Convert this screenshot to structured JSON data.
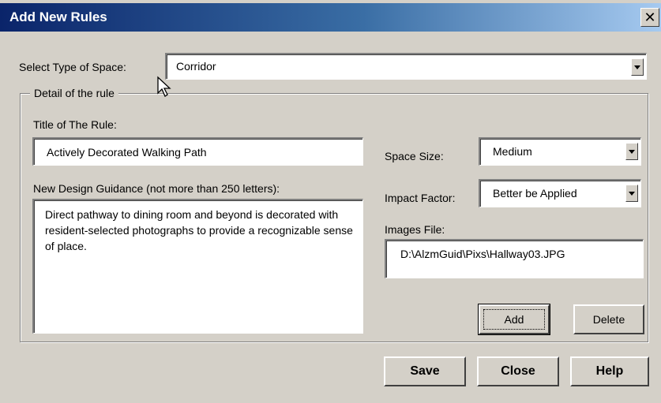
{
  "window": {
    "title": "Add New Rules"
  },
  "space_type": {
    "label": "Select Type of Space:",
    "value": "Corridor"
  },
  "group": {
    "label": "Detail of the rule"
  },
  "rule_title": {
    "label": "Title of The Rule:",
    "value": "Actively Decorated Walking Path"
  },
  "guidance": {
    "label": "New Design Guidance (not more than 250 letters):",
    "value": "Direct pathway to dining room and beyond is decorated with resident-selected photographs to provide a recognizable sense of place."
  },
  "space_size": {
    "label": "Space Size:",
    "value": "Medium"
  },
  "impact_factor": {
    "label": "Impact Factor:",
    "value": "Better be Applied"
  },
  "images_file": {
    "label": "Images File:",
    "value": "D:\\AlzmGuid\\Pixs\\Hallway03.JPG"
  },
  "buttons": {
    "add": "Add",
    "delete": "Delete",
    "save": "Save",
    "close": "Close",
    "help": "Help"
  },
  "icons": {
    "close": "close-icon",
    "dropdown": "chevron-down-icon",
    "cursor": "mouse-pointer-icon"
  }
}
